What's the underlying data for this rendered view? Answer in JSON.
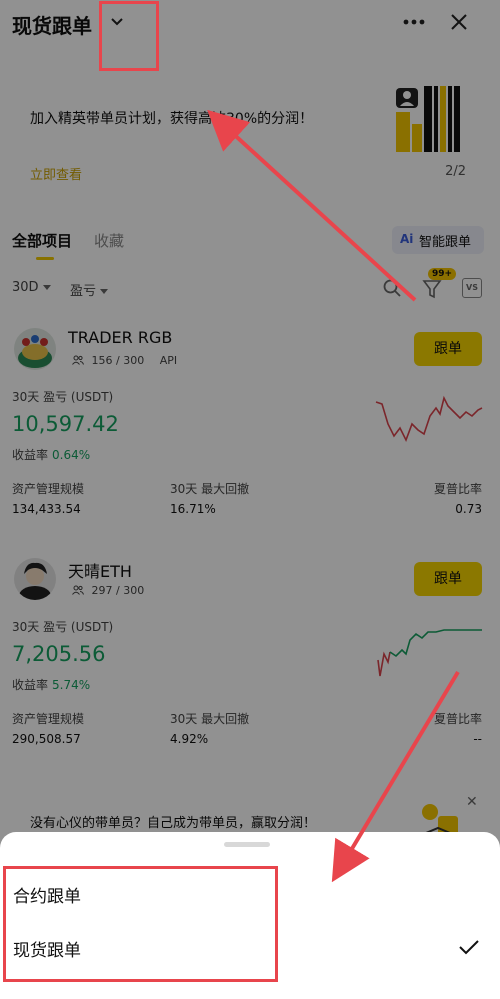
{
  "header": {
    "title": "现货跟单"
  },
  "banner": {
    "text": "加入精英带单员计划，获得高达30%的分润！",
    "link": "立即查看",
    "pager": "2/2"
  },
  "tabs": {
    "all": "全部项目",
    "favorites": "收藏",
    "ai_button": "智能跟单",
    "ai_icon": "Ai"
  },
  "filters": {
    "period": "30D",
    "sort": "盈亏",
    "badge": "99+",
    "vs": "VS"
  },
  "traders": [
    {
      "name": "TRADER RGB",
      "followers": "156 / 300",
      "api": "API",
      "follow_label": "跟单",
      "pnl_label": "30天 盈亏 (USDT)",
      "pnl_value": "10,597.42",
      "roi_label": "收益率",
      "roi_value": "0.64%",
      "aum_label": "资产管理规模",
      "aum_value": "134,433.54",
      "mdd_label": "30天 最大回撤",
      "mdd_value": "16.71%",
      "sharpe_label": "夏普比率",
      "sharpe_value": "0.73"
    },
    {
      "name": "天晴ETH",
      "followers": "297 / 300",
      "follow_label": "跟单",
      "pnl_label": "30天 盈亏 (USDT)",
      "pnl_value": "7,205.56",
      "roi_label": "收益率",
      "roi_value": "5.74%",
      "aum_label": "资产管理规模",
      "aum_value": "290,508.57",
      "mdd_label": "30天 最大回撤",
      "mdd_value": "4.92%",
      "sharpe_label": "夏普比率",
      "sharpe_value": "--"
    }
  ],
  "promo": {
    "text": "没有心仪的带单员？自己成为带单员，赢取分润！",
    "close": "✕"
  },
  "sheet": {
    "options": [
      {
        "label": "合约跟单",
        "selected": false
      },
      {
        "label": "现货跟单",
        "selected": true
      }
    ]
  },
  "colors": {
    "accent_yellow": "#f5d400",
    "positive_green": "#16a060",
    "negative_red": "#d9434c",
    "annotation_red": "#e8454c"
  }
}
